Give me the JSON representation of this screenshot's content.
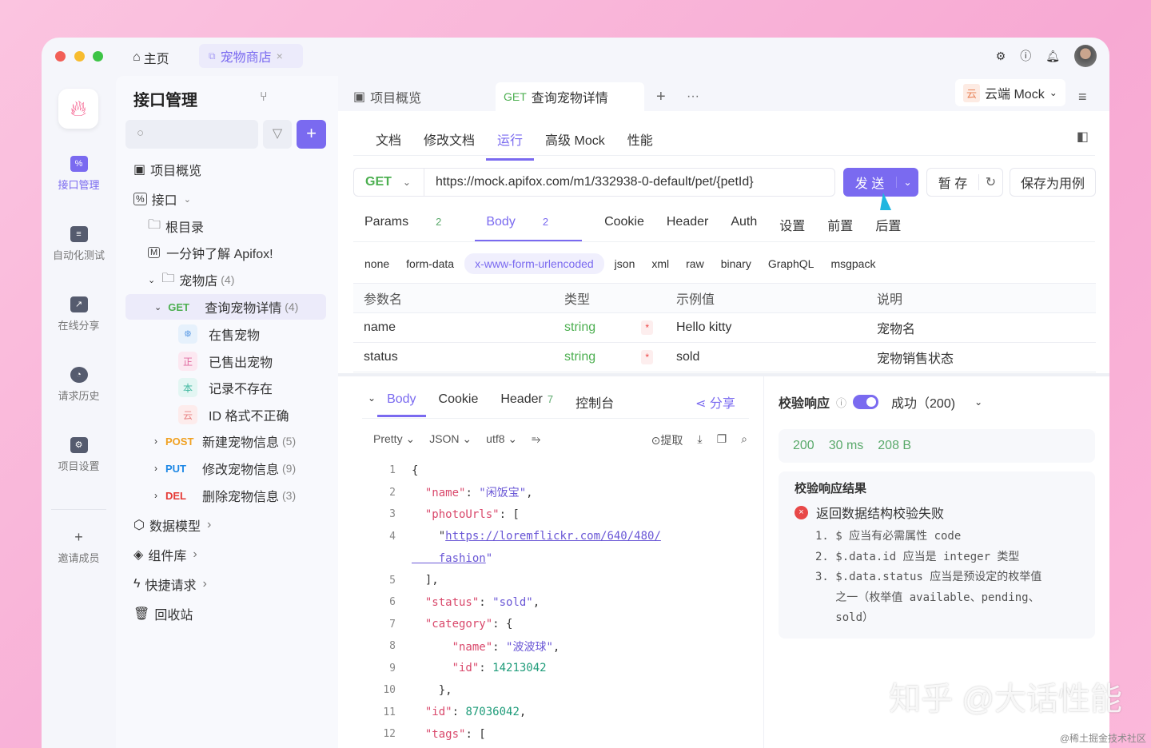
{
  "titlebar": {
    "home": "主页",
    "tab": "宠物商店",
    "close": "×"
  },
  "rail": [
    {
      "label": "接口管理",
      "icon": "%"
    },
    {
      "label": "自动化测试",
      "icon": "≡"
    },
    {
      "label": "在线分享",
      "icon": "↗"
    },
    {
      "label": "请求历史",
      "icon": "◔"
    },
    {
      "label": "项目设置",
      "icon": "⚙"
    },
    {
      "label": "邀请成员",
      "icon": "+"
    }
  ],
  "tree": {
    "title": "接口管理",
    "overview": "项目概览",
    "api": "接口",
    "root": "根目录",
    "doc": "一分钟了解 Apifox!",
    "folder": "宠物店",
    "folder_count": "(4)",
    "get": {
      "method": "GET",
      "name": "查询宠物详情",
      "count": "(4)"
    },
    "cases": [
      {
        "badge": "᪥",
        "label": "在售宠物"
      },
      {
        "badge": "正",
        "label": "已售出宠物"
      },
      {
        "badge": "本",
        "label": "记录不存在"
      },
      {
        "badge": "云",
        "label": "ID 格式不正确"
      }
    ],
    "others": [
      {
        "method": "POST",
        "name": "新建宠物信息",
        "count": "(5)"
      },
      {
        "method": "PUT",
        "name": "修改宠物信息",
        "count": "(9)"
      },
      {
        "method": "DEL",
        "name": "删除宠物信息",
        "count": "(3)"
      }
    ],
    "bottom": [
      "数据模型",
      "组件库",
      "快捷请求",
      "回收站"
    ]
  },
  "tabs": {
    "overview": "项目概览",
    "method": "GET",
    "current": "查询宠物详情",
    "env_badge": "云",
    "env": "云端 Mock"
  },
  "subtabs": [
    "文档",
    "修改文档",
    "运行",
    "高级 Mock",
    "性能"
  ],
  "request": {
    "method": "GET",
    "url": "https://mock.apifox.com/m1/332938-0-default/pet/{petId}",
    "send": "发 送",
    "save_temp": "暂 存",
    "save_case": "保存为用例"
  },
  "ptabs": [
    {
      "label": "Params",
      "count": "2"
    },
    {
      "label": "Body",
      "count": "2"
    },
    {
      "label": "Cookie"
    },
    {
      "label": "Header"
    },
    {
      "label": "Auth"
    },
    {
      "label": "设置"
    },
    {
      "label": "前置"
    },
    {
      "label": "后置"
    }
  ],
  "body_types": [
    "none",
    "form-data",
    "x-www-form-urlencoded",
    "json",
    "xml",
    "raw",
    "binary",
    "GraphQL",
    "msgpack"
  ],
  "params": {
    "headers": [
      "参数名",
      "类型",
      "示例值",
      "说明"
    ],
    "rows": [
      {
        "name": "name",
        "type": "string",
        "req": "*",
        "example": "Hello kitty",
        "desc": "宠物名"
      },
      {
        "name": "status",
        "type": "string",
        "req": "*",
        "example": "sold",
        "desc": "宠物销售状态"
      }
    ]
  },
  "response": {
    "tabs": [
      "Body",
      "Cookie",
      "Header",
      "控制台"
    ],
    "header_count": "7",
    "share": "分享",
    "tools": [
      "Pretty",
      "JSON",
      "utf8"
    ],
    "extract": "提取"
  },
  "code": [
    {
      "n": "1",
      "t": [
        [
          "p",
          "{"
        ]
      ]
    },
    {
      "n": "2",
      "t": [
        [
          "k",
          "  \"name\""
        ],
        [
          "p",
          ": "
        ],
        [
          "s",
          "\"闲饭宝\""
        ],
        [
          "p",
          ","
        ]
      ]
    },
    {
      "n": "3",
      "t": [
        [
          "k",
          "  \"photoUrls\""
        ],
        [
          "p",
          ": ["
        ]
      ]
    },
    {
      "n": "4",
      "t": [
        [
          "p",
          "    \""
        ],
        [
          "lnk",
          "https://loremflickr.com/640/480/"
        ]
      ]
    },
    {
      "n": "",
      "t": [
        [
          "lnk",
          "    fashion"
        ],
        [
          "s",
          "\""
        ]
      ]
    },
    {
      "n": "5",
      "t": [
        [
          "p",
          "  ],"
        ]
      ]
    },
    {
      "n": "6",
      "t": [
        [
          "k",
          "  \"status\""
        ],
        [
          "p",
          ": "
        ],
        [
          "s",
          "\"sold\""
        ],
        [
          "p",
          ","
        ]
      ]
    },
    {
      "n": "7",
      "t": [
        [
          "k",
          "  \"category\""
        ],
        [
          "p",
          ": {"
        ]
      ]
    },
    {
      "n": "8",
      "t": [
        [
          "k",
          "      \"name\""
        ],
        [
          "p",
          ": "
        ],
        [
          "s",
          "\"波波球\""
        ],
        [
          "p",
          ","
        ]
      ]
    },
    {
      "n": "9",
      "t": [
        [
          "k",
          "      \"id\""
        ],
        [
          "p",
          ": "
        ],
        [
          "num",
          "14213042"
        ]
      ]
    },
    {
      "n": "10",
      "t": [
        [
          "p",
          "    },"
        ]
      ]
    },
    {
      "n": "11",
      "t": [
        [
          "k",
          "  \"id\""
        ],
        [
          "p",
          ": "
        ],
        [
          "num",
          "87036042"
        ],
        [
          "p",
          ","
        ]
      ]
    },
    {
      "n": "12",
      "t": [
        [
          "k",
          "  \"tags\""
        ],
        [
          "p",
          ": ["
        ]
      ]
    }
  ],
  "validate": {
    "label": "校验响应",
    "status": "成功（200)",
    "code": "200",
    "time": "30 ms",
    "size": "208 B",
    "result_title": "校验响应结果",
    "fail": "返回数据结构校验失败",
    "errors": [
      "1. $ 应当有必需属性 code",
      "2. $.data.id 应当是 integer 类型",
      "3. $.data.status 应当是预设定的枚举值",
      "   之一（枚举值 available、pending、",
      "   sold）"
    ]
  },
  "watermark": "知乎 @大话性能",
  "watermark2": "@稀土掘金技术社区",
  "colors": {
    "accent": "#7a6af0",
    "get": "#4caf50",
    "post": "#f0a020",
    "put": "#1e88e5",
    "del": "#e53935"
  }
}
